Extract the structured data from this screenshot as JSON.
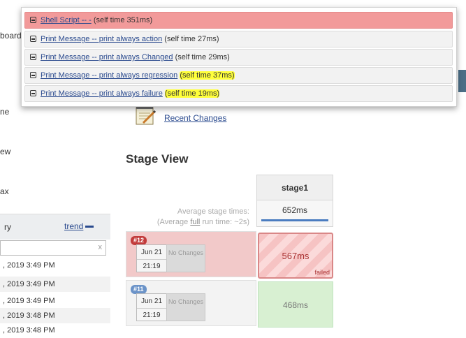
{
  "sidebar": {
    "links": [
      "board",
      "ne",
      "ew",
      "ax"
    ],
    "history": {
      "title": "ry",
      "trend_label": "trend",
      "filter_clear": "x",
      "rows": [
        ", 2019 3:49 PM",
        ", 2019 3:49 PM",
        ", 2019 3:49 PM",
        ", 2019 3:48 PM",
        ", 2019 3:48 PM"
      ]
    }
  },
  "top_crumb": "»",
  "popup": {
    "rows": [
      {
        "link": "Shell Script -- -",
        "time": "(self time 351ms)",
        "status": "failed"
      },
      {
        "link": "Print Message -- print always action",
        "time": "(self time 27ms)",
        "status": "success"
      },
      {
        "link": "Print Message -- print always Changed",
        "time": "(self time 29ms)",
        "status": "success"
      },
      {
        "link": "Print Message -- print always regression",
        "time": "(self time 37ms)",
        "status": "success",
        "highlight": "time"
      },
      {
        "link": "Print Message -- print always failure",
        "time": "(self time 19ms)",
        "status": "success",
        "highlight": "time"
      }
    ]
  },
  "main": {
    "recent_changes": "Recent Changes",
    "stage_view_title": "Stage View",
    "stage_name": "stage1",
    "avg_label_line1": "Average stage times:",
    "avg_label_line2_prefix": "(Average",
    "avg_label_full": "full",
    "avg_label_line2_suffix": "run time: ~2s)",
    "avg_time": "652ms",
    "runs": [
      {
        "badge": "#12",
        "date": "Jun 21",
        "time": "21:19",
        "no_changes": "No Changes",
        "stage_time": "567ms",
        "stage_status": "failed"
      },
      {
        "badge": "#11",
        "date": "Jun 21",
        "time": "21:19",
        "no_changes": "No Changes",
        "stage_time": "468ms",
        "stage_status": ""
      }
    ]
  },
  "colors": {
    "failed_row": "#f29a9a",
    "highlight": "#ffff3a",
    "link": "#2a4a8e",
    "success_cell": "#d8f0d2"
  }
}
